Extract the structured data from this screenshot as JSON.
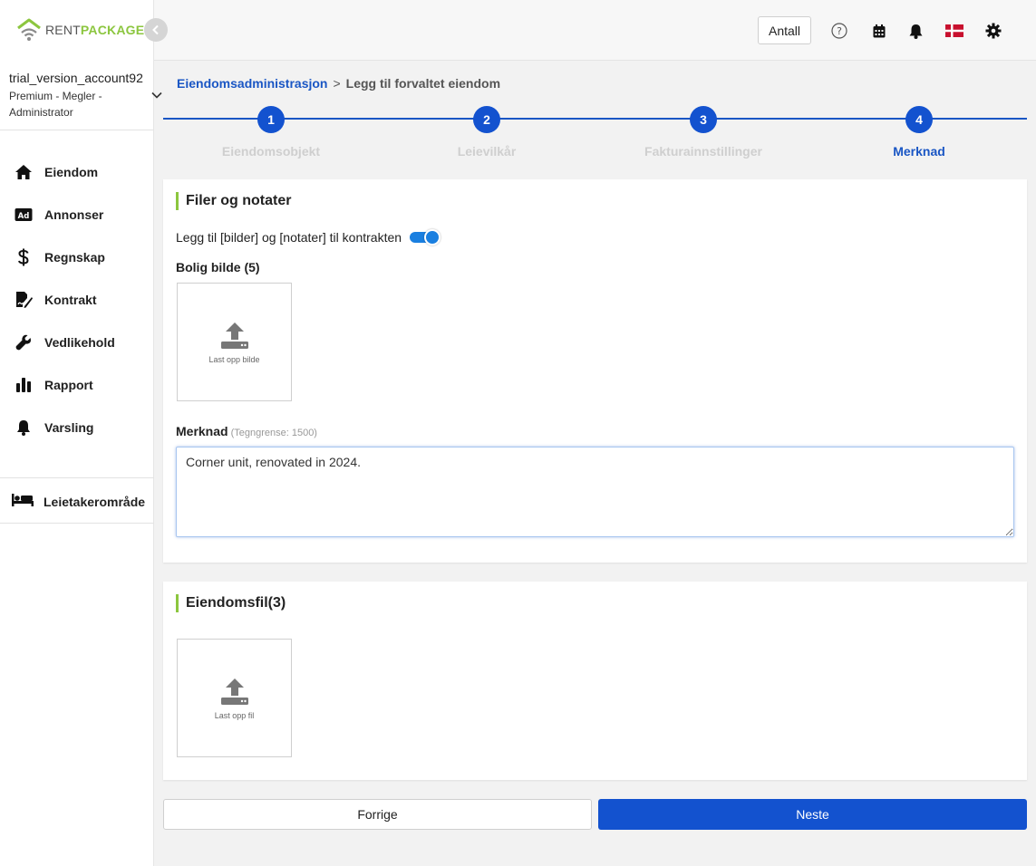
{
  "brand": {
    "name_part1": "RENT",
    "name_part2": "PACKAGE"
  },
  "account": {
    "name": "trial_version_account92",
    "role": "Premium - Megler - Administrator"
  },
  "sidebar": {
    "items": [
      {
        "label": "Eiendom",
        "icon": "home-icon"
      },
      {
        "label": "Annonser",
        "icon": "ad-icon"
      },
      {
        "label": "Regnskap",
        "icon": "dollar-icon"
      },
      {
        "label": "Kontrakt",
        "icon": "contract-icon"
      },
      {
        "label": "Vedlikehold",
        "icon": "wrench-icon"
      },
      {
        "label": "Rapport",
        "icon": "bar-chart-icon"
      },
      {
        "label": "Varsling",
        "icon": "bell-icon"
      }
    ],
    "tenant_area": {
      "label": "Leietakerområde",
      "icon": "bed-icon"
    }
  },
  "header": {
    "antall_label": "Antall"
  },
  "breadcrumb": {
    "parent": "Eiendomsadministrasjon",
    "separator": ">",
    "current": "Legg til forvaltet eiendom"
  },
  "stepper": {
    "steps": [
      {
        "number": "1",
        "label": "Eiendomsobjekt"
      },
      {
        "number": "2",
        "label": "Leievilkår"
      },
      {
        "number": "3",
        "label": "Fakturainnstillinger"
      },
      {
        "number": "4",
        "label": "Merknad"
      }
    ],
    "active_step": 4
  },
  "files_notes": {
    "title": "Filer og notater",
    "toggle_label": "Legg til [bilder] og [notater] til kontrakten",
    "toggle_on": true,
    "photo_label": "Bolig bilde (5)",
    "photo_upload_text": "Last opp bilde",
    "note_label": "Merknad",
    "note_hint": "(Tegngrense: 1500)",
    "note_value": "Corner unit, renovated in 2024."
  },
  "property_files": {
    "title": "Eiendomsfil(3)",
    "upload_text": "Last opp fil"
  },
  "footer": {
    "prev_label": "Forrige",
    "next_label": "Neste"
  },
  "colors": {
    "primary": "#1352cf",
    "accent_green": "#8cc63f",
    "toggle_blue": "#1a7fe0"
  }
}
